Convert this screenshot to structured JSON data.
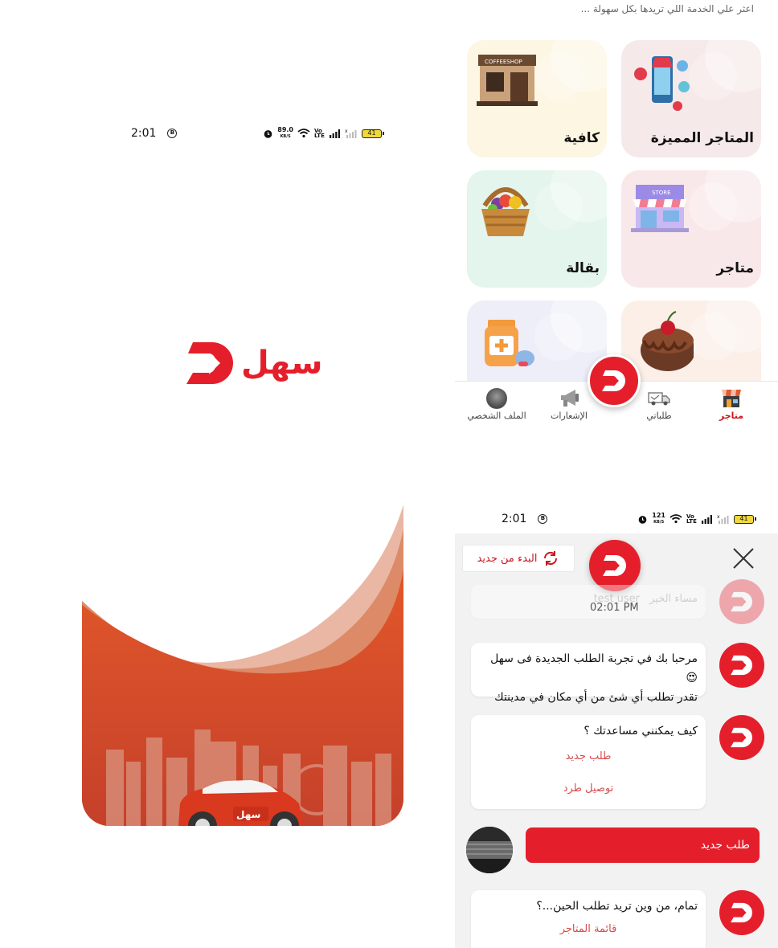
{
  "colors": {
    "brand_red": "#e41f2b",
    "dark_red": "#c8171f",
    "promo_orange": "#d9502a"
  },
  "splash": {
    "status": {
      "time": "2:01",
      "speed": "89.0",
      "speed_unit": "KB/S",
      "volte": "Vo LTE",
      "battery": "41"
    },
    "logo_text": "سهل"
  },
  "promo": {
    "car_logo_text": "سهل"
  },
  "stores": {
    "hint": "اعثر علي الخدمة اللي تريدها بكل سهولة ...",
    "tiles": [
      {
        "label": "المتاجر المميزة",
        "bg": "#f6e9e9",
        "icon": "featured-stores-icon"
      },
      {
        "label": "كافية",
        "bg": "#fcf6e2",
        "icon": "coffeeshop-icon",
        "sign": "COFFEESHOP"
      },
      {
        "label": "متاجر",
        "bg": "#f9e8ea",
        "icon": "store-icon",
        "sign": "STORE"
      },
      {
        "label": "بقالة",
        "bg": "#e3f5ec",
        "icon": "grocery-basket-icon"
      },
      {
        "label": "",
        "bg": "#fbefe8",
        "icon": "cake-icon"
      },
      {
        "label": "",
        "bg": "#eeeef9",
        "icon": "pharmacy-icon"
      }
    ],
    "nav": [
      {
        "label": "متاجر",
        "icon": "store-nav-icon",
        "active": true
      },
      {
        "label": "طلباتي",
        "icon": "delivery-truck-icon"
      },
      {
        "label": "الإشعارات",
        "icon": "megaphone-icon"
      },
      {
        "label": "الملف الشخصي",
        "icon": "profile-avatar-icon"
      }
    ]
  },
  "chat": {
    "status": {
      "time": "2:01",
      "speed": "121",
      "speed_unit": "KB/S",
      "volte": "Vo LTE",
      "battery": "41"
    },
    "restart_label": "البدء من جديد",
    "greeting": "مساء الخير",
    "user_name": "test user",
    "timestamp": "02:01 PM",
    "welcome_line1": "مرحبا بك في تجربة الطلب الجديدة فى سهل😍",
    "welcome_line2": "تقدر تطلب أي شئ من أي مكان في مدينتك",
    "help_question": "كيف يمكنني مساعدتك ؟",
    "help_options": [
      "طلب جديد",
      "توصيل طرد"
    ],
    "user_reply": "طلب جديد",
    "where_question": "تمام، من وين تريد تطلب الحين...؟",
    "where_options": [
      "قائمة المتاجر"
    ]
  }
}
